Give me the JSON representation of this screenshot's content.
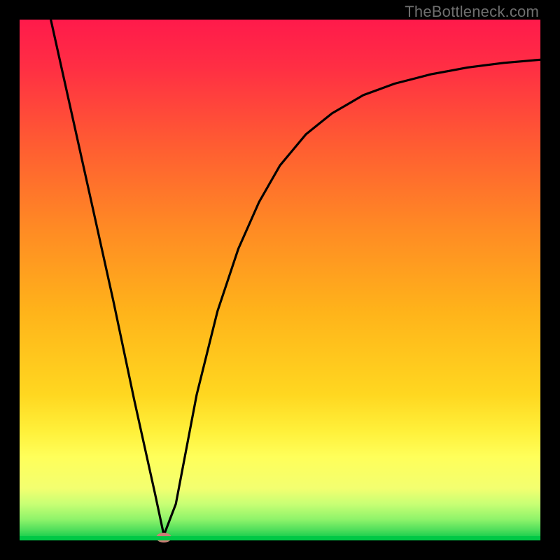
{
  "watermark": "TheBottleneck.com",
  "gradient_colors": {
    "c0": "#ff1a4b",
    "c1": "#ff2e44",
    "c2": "#ff5c32",
    "c3": "#ff8a24",
    "c4": "#ffb31a",
    "c5": "#ffd720",
    "c6": "#fff03a",
    "c7": "#ffff5a",
    "c8": "#f3ff70",
    "c9": "#c8ff74",
    "c10": "#8ef36a",
    "c11": "#4fde5c",
    "c12": "#00c846"
  },
  "chart_data": {
    "type": "line",
    "title": "",
    "xlabel": "",
    "ylabel": "",
    "xlim": [
      0,
      1
    ],
    "ylim": [
      0,
      1
    ],
    "series": [
      {
        "name": "curve",
        "x": [
          0.06,
          0.1,
          0.14,
          0.18,
          0.22,
          0.26,
          0.277,
          0.3,
          0.34,
          0.38,
          0.42,
          0.46,
          0.5,
          0.55,
          0.6,
          0.66,
          0.72,
          0.79,
          0.86,
          0.93,
          1.0
        ],
        "y": [
          1.0,
          0.82,
          0.64,
          0.46,
          0.27,
          0.09,
          0.01,
          0.07,
          0.28,
          0.44,
          0.56,
          0.65,
          0.72,
          0.78,
          0.82,
          0.855,
          0.877,
          0.895,
          0.908,
          0.917,
          0.923
        ]
      }
    ],
    "annotations": [
      {
        "name": "min-marker",
        "x": 0.277,
        "y": 0.005
      }
    ]
  }
}
